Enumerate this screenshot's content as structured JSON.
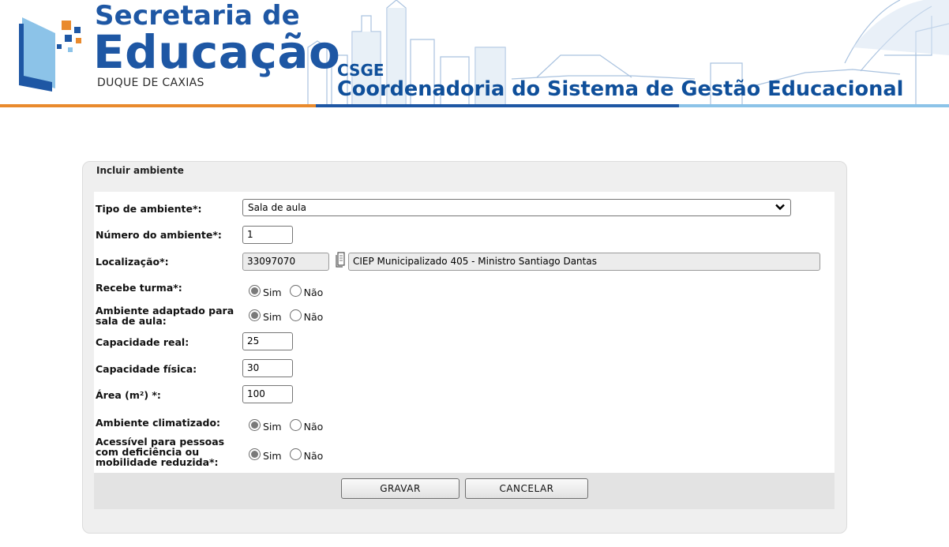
{
  "header": {
    "brand_line1": "Secretaria de",
    "brand_line2": "Educação",
    "brand_line3": "DUQUE DE CAXIAS",
    "csge_short": "CSGE",
    "csge_long": "Coordenadoria do Sistema de Gestão Educacional"
  },
  "colors": {
    "brand_blue": "#1e57a4",
    "stripe_orange": "#e98a2d",
    "stripe_blue": "#1e57a4",
    "stripe_light_blue": "#8cc3e8"
  },
  "panel": {
    "title": "Incluir ambiente"
  },
  "form": {
    "tipo_ambiente": {
      "label": "Tipo de ambiente*:",
      "selected": "Sala de aula"
    },
    "numero_ambiente": {
      "label": "Número do ambiente*:",
      "value": "1"
    },
    "localizacao": {
      "label": "Localização*:",
      "code": "33097070",
      "name": "CIEP Municipalizado 405 - Ministro Santiago Dantas",
      "icon": "document-icon"
    },
    "recebe_turma": {
      "label": "Recebe turma*:",
      "yes": "Sim",
      "no": "Não",
      "selected": "Sim"
    },
    "adaptado": {
      "label_line1": "Ambiente adaptado para",
      "label_line2": "sala de aula:",
      "yes": "Sim",
      "no": "Não",
      "selected": "Sim"
    },
    "capacidade_real": {
      "label": "Capacidade real:",
      "value": "25"
    },
    "capacidade_fisica": {
      "label": "Capacidade física:",
      "value": "30"
    },
    "area": {
      "label": "Área (m²) *:",
      "value": "100"
    },
    "climatizado": {
      "label": "Ambiente climatizado:",
      "yes": "Sim",
      "no": "Não",
      "selected": "Sim"
    },
    "acessivel": {
      "label_line1": "Acessível para pessoas",
      "label_line2": "com deficiência ou",
      "label_line3": "mobilidade reduzida*:",
      "yes": "Sim",
      "no": "Não",
      "selected": "Sim"
    }
  },
  "buttons": {
    "save": "GRAVAR",
    "cancel": "CANCELAR"
  }
}
